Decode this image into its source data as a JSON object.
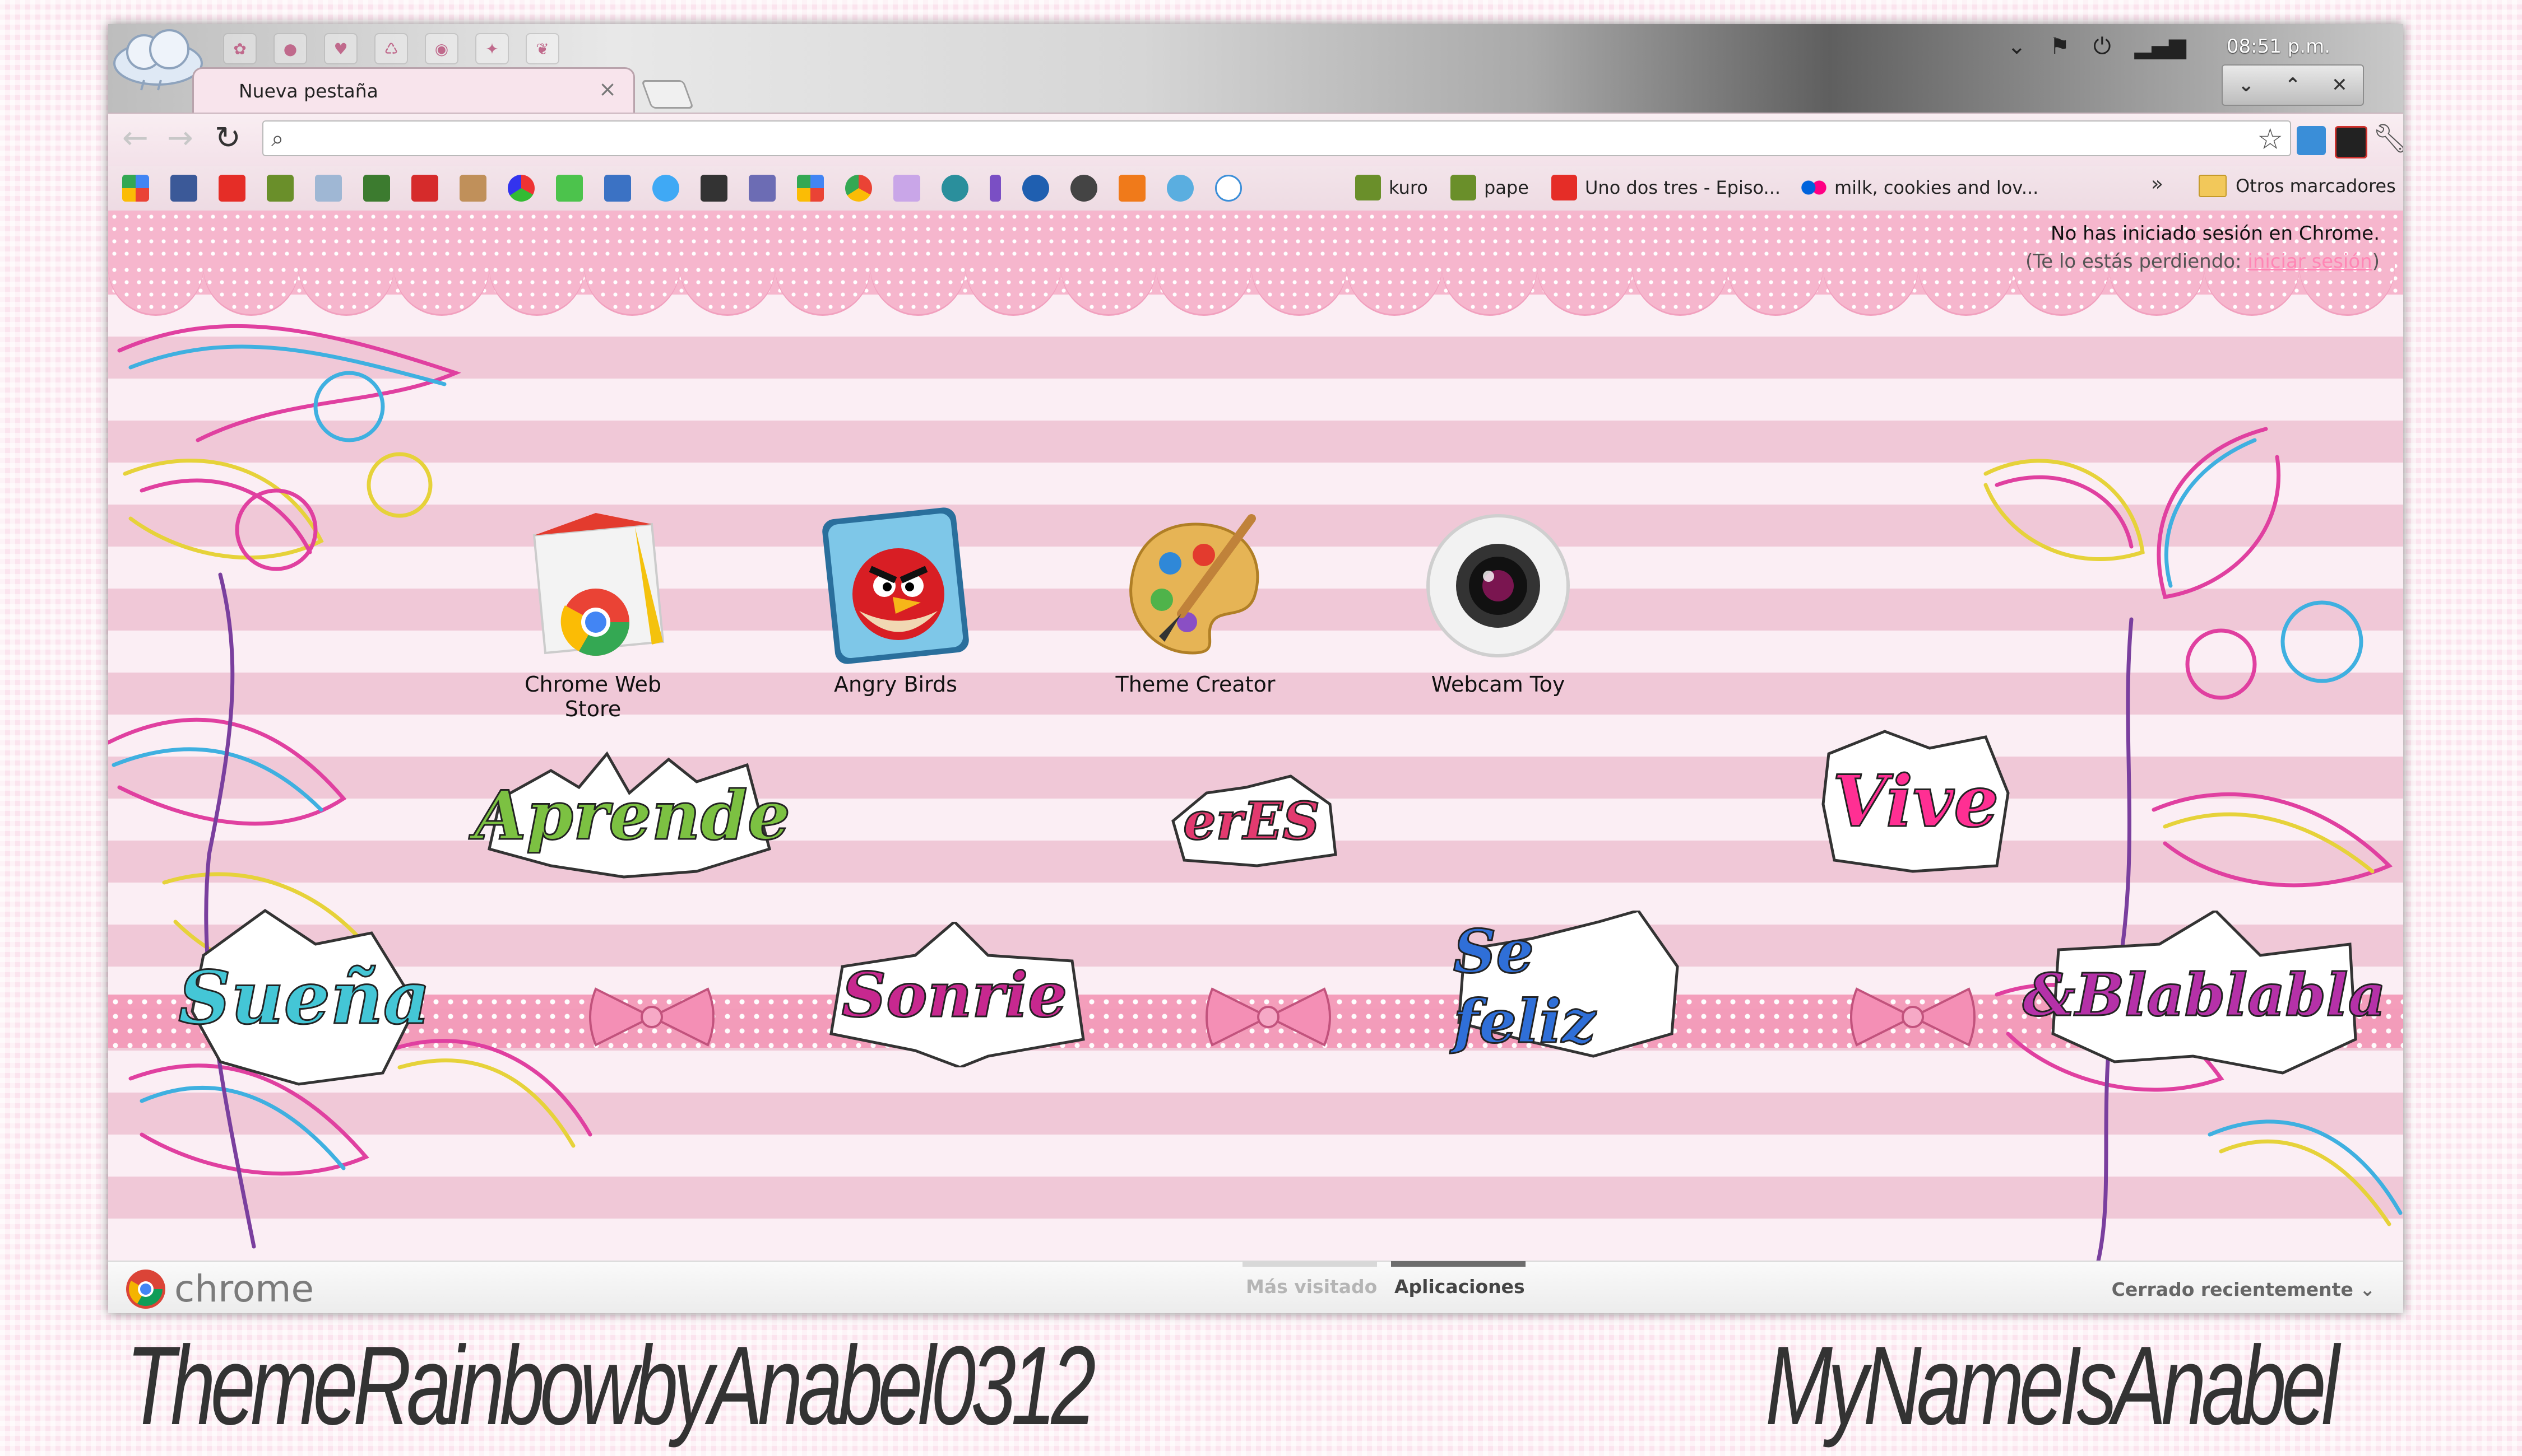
{
  "window": {
    "tab_title": "Nueva pestaña",
    "clock": "08:51 p.m."
  },
  "toolbar": {
    "search_placeholder": ""
  },
  "bookmarks": {
    "items": [
      {
        "label": "kuro"
      },
      {
        "label": "pape"
      },
      {
        "label": "Uno dos tres - Episo..."
      },
      {
        "label": "milk, cookies and lov..."
      }
    ],
    "more": "»",
    "other": "Otros marcadores"
  },
  "signin": {
    "line1": "No has iniciado sesión en Chrome.",
    "line2_prefix": "(Te lo estás perdiendo: ",
    "link": "iniciar sesión",
    "line2_suffix": ")"
  },
  "apps": [
    {
      "label": "Chrome Web Store",
      "icon": "chrome-web-store-icon"
    },
    {
      "label": "Angry Birds",
      "icon": "angry-birds-icon"
    },
    {
      "label": "Theme Creator",
      "icon": "paint-palette-icon"
    },
    {
      "label": "Webcam Toy",
      "icon": "webcam-icon"
    }
  ],
  "stickers": [
    "Aprende",
    "erES",
    "Vive",
    "Sueña",
    "Sonrie",
    "Se feliz",
    "&Blablabla"
  ],
  "footer": {
    "brand": "chrome",
    "tab_most_visited": "Más visitado",
    "tab_apps": "Aplicaciones",
    "recently_closed": "Cerrado recientemente"
  },
  "credits": {
    "left": "ThemeRainbowbyAnabel0312",
    "right": "MyNameIsAnabel"
  },
  "colors": {
    "accent_pink": "#f49ab9",
    "link_pink": "#ff86b5",
    "stripe_light": "#fbeef4",
    "stripe_dark": "#f0c8d7"
  }
}
